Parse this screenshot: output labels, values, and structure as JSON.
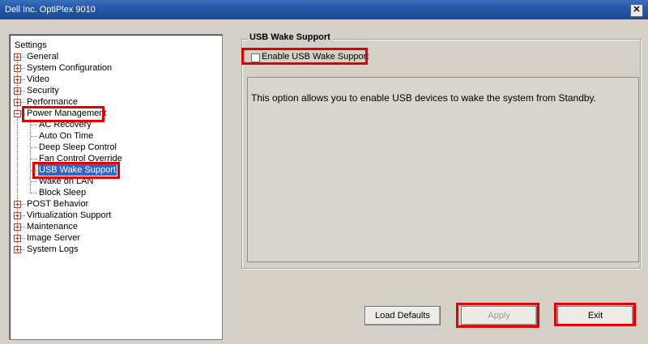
{
  "window": {
    "title": "Dell Inc. OptiPlex 9010",
    "close_glyph": "✕"
  },
  "tree": {
    "root_label": "Settings",
    "top_items": [
      {
        "label": "General",
        "expanded": false
      },
      {
        "label": "System Configuration",
        "expanded": false
      },
      {
        "label": "Video",
        "expanded": false
      },
      {
        "label": "Security",
        "expanded": false
      },
      {
        "label": "Performance",
        "expanded": false
      },
      {
        "label": "Power Management",
        "expanded": true
      },
      {
        "label": "POST Behavior",
        "expanded": false
      },
      {
        "label": "Virtualization Support",
        "expanded": false
      },
      {
        "label": "Maintenance",
        "expanded": false
      },
      {
        "label": "Image Server",
        "expanded": false
      },
      {
        "label": "System Logs",
        "expanded": false
      }
    ],
    "power_children": [
      "AC Recovery",
      "Auto On Time",
      "Deep Sleep Control",
      "Fan Control Override",
      "USB Wake Support",
      "Wake on LAN",
      "Block Sleep"
    ],
    "selected_item": "USB Wake Support"
  },
  "panel": {
    "group_title": "USB Wake Support",
    "checkbox_label": "Enable USB Wake Support",
    "checkbox_checked": false,
    "description": "This option allows you to enable USB devices to wake the system from Standby."
  },
  "buttons": {
    "load_defaults": "Load Defaults",
    "apply": "Apply",
    "exit": "Exit"
  },
  "colors": {
    "highlight_box": "#e00000",
    "selection": "#3166c5",
    "titlebar": "#2456a8"
  }
}
